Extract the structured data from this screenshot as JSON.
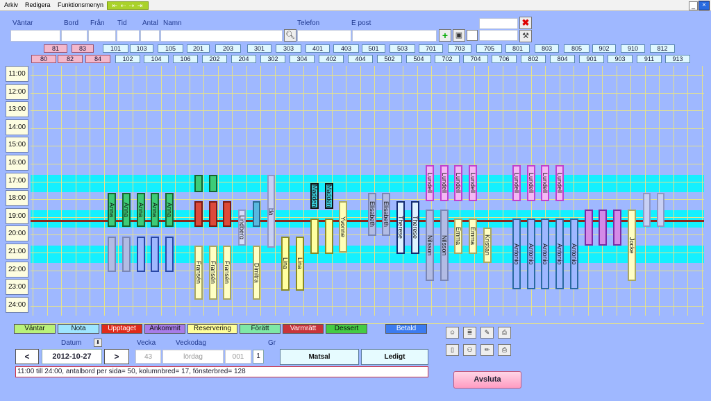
{
  "menu": {
    "items": [
      "Arkiv",
      "Redigera",
      "Funktionsmenyn"
    ],
    "nav_glyphs": "⇤ ⇠ ⇢ ⇥",
    "min": "_",
    "close": "×"
  },
  "fields": {
    "vantar": "Väntar",
    "bord": "Bord",
    "fran": "Från",
    "tid": "Tid",
    "antal": "Antal",
    "namn": "Namn",
    "telefon": "Telefon",
    "epost": "E post"
  },
  "tables_top": [
    "81",
    "83",
    "101",
    "103",
    "105",
    "201",
    "203",
    "301",
    "303",
    "401",
    "403",
    "501",
    "503",
    "701",
    "703",
    "705",
    "801",
    "803",
    "805",
    "902",
    "910",
    "812"
  ],
  "tables_bottom": [
    "80",
    "82",
    "84",
    "102",
    "104",
    "106",
    "202",
    "204",
    "302",
    "304",
    "402",
    "404",
    "502",
    "504",
    "702",
    "704",
    "706",
    "802",
    "804",
    "901",
    "903",
    "911",
    "913"
  ],
  "hours": [
    "11:00",
    "12:00",
    "13:00",
    "14:00",
    "15:00",
    "16:00",
    "17:00",
    "18:00",
    "19:00",
    "20:00",
    "21:00",
    "22:00",
    "23:00",
    "24:00"
  ],
  "bookings": [
    {
      "label": "Anna"
    },
    {
      "label": "Anna"
    },
    {
      "label": "Anna"
    },
    {
      "label": "Anna"
    },
    {
      "label": "Anna"
    },
    {
      "label": ""
    },
    {
      "label": ""
    },
    {
      "label": ""
    },
    {
      "label": ""
    },
    {
      "label": ""
    },
    {
      "label": ""
    },
    {
      "label": ""
    },
    {
      "label": ""
    },
    {
      "label": ""
    },
    {
      "label": ""
    },
    {
      "label": "Fransén"
    },
    {
      "label": "Fransén"
    },
    {
      "label": "Fransén"
    },
    {
      "label": "Lindberg"
    },
    {
      "label": ""
    },
    {
      "label": "Ida"
    },
    {
      "label": ""
    },
    {
      "label": "Dimitra"
    },
    {
      "label": "Lina"
    },
    {
      "label": "Lina"
    },
    {
      "label": "Madden"
    },
    {
      "label": "Madden"
    },
    {
      "label": ""
    },
    {
      "label": ""
    },
    {
      "label": "Yvonne"
    },
    {
      "label": "Elisabeth"
    },
    {
      "label": "Elisabeth"
    },
    {
      "label": "Therese"
    },
    {
      "label": "Therese"
    },
    {
      "label": "Lundell"
    },
    {
      "label": "Lundell"
    },
    {
      "label": "Lundell"
    },
    {
      "label": "Lundell"
    },
    {
      "label": "Nilsson"
    },
    {
      "label": "Nilsson"
    },
    {
      "label": "Emma"
    },
    {
      "label": "Emma"
    },
    {
      "label": "Kristian"
    },
    {
      "label": "Lundell"
    },
    {
      "label": "Lundell"
    },
    {
      "label": "Lundell"
    },
    {
      "label": "Lundell"
    },
    {
      "label": "Antonio"
    },
    {
      "label": "Antonio"
    },
    {
      "label": "Antonio"
    },
    {
      "label": "Antonio"
    },
    {
      "label": "Antonio"
    },
    {
      "label": ""
    },
    {
      "label": ""
    },
    {
      "label": ""
    },
    {
      "label": ""
    },
    {
      "label": "Jocke"
    },
    {
      "label": ""
    },
    {
      "label": ""
    }
  ],
  "legend": {
    "vantar": "Väntar",
    "nota": "Nota",
    "upptaget": "Upptaget",
    "ankommit": "Ankommit",
    "reservering": "Reservering",
    "foratt": "Förätt",
    "varmratt": "Varmrätt",
    "dessert": "Dessert",
    "betald": "Betald"
  },
  "date": {
    "label": "Datum",
    "prev": "<",
    "next": ">",
    "value": "2012-10-27",
    "vecka_label": "Vecka",
    "veckodag_label": "Veckodag",
    "gr_label": "Gr",
    "vecka": "43",
    "veckodag": "lördag",
    "code": "001",
    "gr": "1"
  },
  "buttons": {
    "matsal": "Matsal",
    "ledigt": "Ledigt",
    "avsluta": "Avsluta"
  },
  "status": "11:00 till 24:00, antalbord per sida= 50, kolumnbred= 17, fönsterbred= 128"
}
